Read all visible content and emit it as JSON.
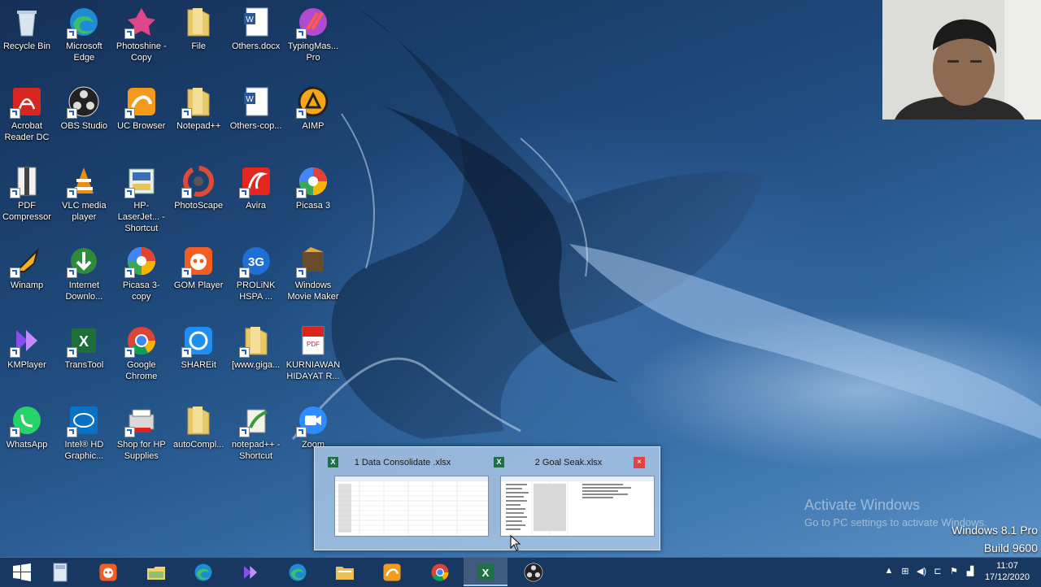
{
  "desktop": {
    "icons": [
      {
        "label": "Recycle Bin",
        "icon": "recycle-bin-icon"
      },
      {
        "label": "Microsoft Edge",
        "icon": "edge-icon"
      },
      {
        "label": "Photoshine - Copy",
        "icon": "photoshine-icon"
      },
      {
        "label": "File",
        "icon": "folder-icon"
      },
      {
        "label": "Others.docx",
        "icon": "word-doc-icon"
      },
      {
        "label": "TypingMas... Pro",
        "icon": "typingmaster-icon"
      },
      {
        "label": "Acrobat Reader DC",
        "icon": "acrobat-icon"
      },
      {
        "label": "OBS Studio",
        "icon": "obs-icon"
      },
      {
        "label": "UC Browser",
        "icon": "uc-browser-icon"
      },
      {
        "label": "Notepad++",
        "icon": "folder-icon"
      },
      {
        "label": "Others-cop...",
        "icon": "word-doc-icon"
      },
      {
        "label": "AIMP",
        "icon": "aimp-icon"
      },
      {
        "label": "PDF Compressor",
        "icon": "pdf-compressor-icon"
      },
      {
        "label": "VLC media player",
        "icon": "vlc-icon"
      },
      {
        "label": "HP-LaserJet... - Shortcut",
        "icon": "hp-printer-icon"
      },
      {
        "label": "PhotoScape",
        "icon": "photoscape-icon"
      },
      {
        "label": "Avira",
        "icon": "avira-icon"
      },
      {
        "label": "Picasa 3",
        "icon": "picasa-icon"
      },
      {
        "label": "Winamp",
        "icon": "winamp-icon"
      },
      {
        "label": "Internet Downlo...",
        "icon": "idm-icon"
      },
      {
        "label": "Picasa 3-copy",
        "icon": "picasa-icon"
      },
      {
        "label": "GOM Player",
        "icon": "gom-player-icon"
      },
      {
        "label": "PROLiNK HSPA ...",
        "icon": "prolink-icon"
      },
      {
        "label": "Windows Movie Maker",
        "icon": "movie-maker-icon"
      },
      {
        "label": "KMPlayer",
        "icon": "kmplayer-icon"
      },
      {
        "label": "TransTool",
        "icon": "transtool-icon"
      },
      {
        "label": "Google Chrome",
        "icon": "chrome-icon"
      },
      {
        "label": "SHAREit",
        "icon": "shareit-icon"
      },
      {
        "label": "[www.giga...",
        "icon": "folder-icon"
      },
      {
        "label": "KURNIAWAN HIDAYAT R...",
        "icon": "pdf-file-icon"
      },
      {
        "label": "WhatsApp",
        "icon": "whatsapp-icon"
      },
      {
        "label": "Intel® HD Graphic...",
        "icon": "intel-graphics-icon"
      },
      {
        "label": "Shop for HP Supplies",
        "icon": "hp-supplies-icon"
      },
      {
        "label": "autoCompl...",
        "icon": "folder-icon"
      },
      {
        "label": "notepad++ - Shortcut",
        "icon": "notepadpp-icon"
      },
      {
        "label": "Zoom",
        "icon": "zoom-icon"
      }
    ]
  },
  "thumbnail_preview": {
    "windows": [
      {
        "title": "1 Data Consolidate .xlsx",
        "app_icon": "excel-icon"
      },
      {
        "title": "2 Goal Seak.xlsx",
        "app_icon": "excel-icon",
        "close_label": "×"
      }
    ]
  },
  "watermark": {
    "line1": "Activate Windows",
    "line2": "Go to PC settings to activate Windows."
  },
  "os_build": {
    "line1": "Windows 8.1 Pro",
    "line2": "Build 9600"
  },
  "taskbar": {
    "items": [
      {
        "icon": "start-windows-icon"
      },
      {
        "icon": "calculator-icon"
      },
      {
        "icon": "gom-player-icon"
      },
      {
        "icon": "file-explorer-folders-icon"
      },
      {
        "icon": "edge-icon"
      },
      {
        "icon": "kmplayer-icon"
      },
      {
        "icon": "edge-icon"
      },
      {
        "icon": "file-explorer-icon"
      },
      {
        "icon": "uc-browser-icon"
      },
      {
        "icon": "chrome-icon"
      },
      {
        "icon": "excel-icon",
        "active": true
      },
      {
        "icon": "obs-icon"
      }
    ],
    "tray": {
      "time": "11:07",
      "date": "17/12/2020"
    }
  },
  "colors": {
    "taskbar": "#183862",
    "accent_excel": "#1e7145",
    "close_red": "#e04343"
  }
}
